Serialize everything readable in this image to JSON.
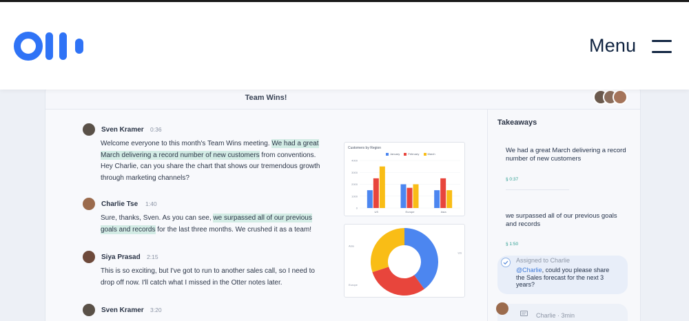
{
  "header": {
    "menu_label": "Menu"
  },
  "app": {
    "title": "Team Wins!",
    "transcript": [
      {
        "speaker": "Sven Kramer",
        "time": "0:36",
        "text_before": "Welcome everyone to this month's Team Wins meeting. ",
        "highlight": "We had a great March delivering a record number of new customers",
        "text_after": " from conventions. Hey Charlie, can you share the chart that shows our tremendous growth through marketing channels?"
      },
      {
        "speaker": "Charlie Tse",
        "time": "1:40",
        "text_before": "Sure, thanks, Sven. As you can see, ",
        "highlight": "we surpassed all of our previous goals and records",
        "text_after": " for the last three months. We crushed it as a team!"
      },
      {
        "speaker": "Siya Prasad",
        "time": "2:15",
        "text_before": "This is so exciting, but I've got to run to another sales call, so I need to drop off now. I'll catch what I missed in the Otter notes later.",
        "highlight": "",
        "text_after": ""
      },
      {
        "speaker": "Sven Kramer",
        "time": "3:20",
        "text_before": "",
        "highlight": "",
        "text_after": ""
      }
    ],
    "takeaways": {
      "title": "Takeaways",
      "items": [
        {
          "text": "We had a great March delivering a record number of new customers",
          "time": "0:37"
        },
        {
          "text": "we surpassed all of our previous goals and records",
          "time": "1:50"
        }
      ],
      "assignment": {
        "label": "Assigned to Charlie",
        "mention": "@Charlie",
        "text": ", could you please share the Sales forecast for the next 3 years?"
      },
      "comment": {
        "meta": "Charlie · 3min"
      }
    }
  },
  "colors": {
    "brand": "#2f73f6",
    "highlight": "#d3ece5",
    "series_blue": "#4c86f0",
    "series_red": "#e8453c",
    "series_yellow": "#f9bd16"
  },
  "chart_data": [
    {
      "type": "bar",
      "title": "Customers by Region",
      "categories": [
        "US",
        "Europe",
        "Asia"
      ],
      "series": [
        {
          "name": "January",
          "values": [
            1500,
            2000,
            1500
          ]
        },
        {
          "name": "February",
          "values": [
            2500,
            1700,
            2500
          ]
        },
        {
          "name": "March",
          "values": [
            3500,
            2000,
            1500
          ]
        }
      ],
      "ytick_labels": [
        "0",
        "1000",
        "2000",
        "3000",
        "4000"
      ],
      "ylim": [
        0,
        4000
      ]
    },
    {
      "type": "pie",
      "style": "donut",
      "slices": [
        {
          "label": "US",
          "value": 40
        },
        {
          "label": "Europe",
          "value": 30
        },
        {
          "label": "Asia",
          "value": 30
        }
      ]
    }
  ]
}
